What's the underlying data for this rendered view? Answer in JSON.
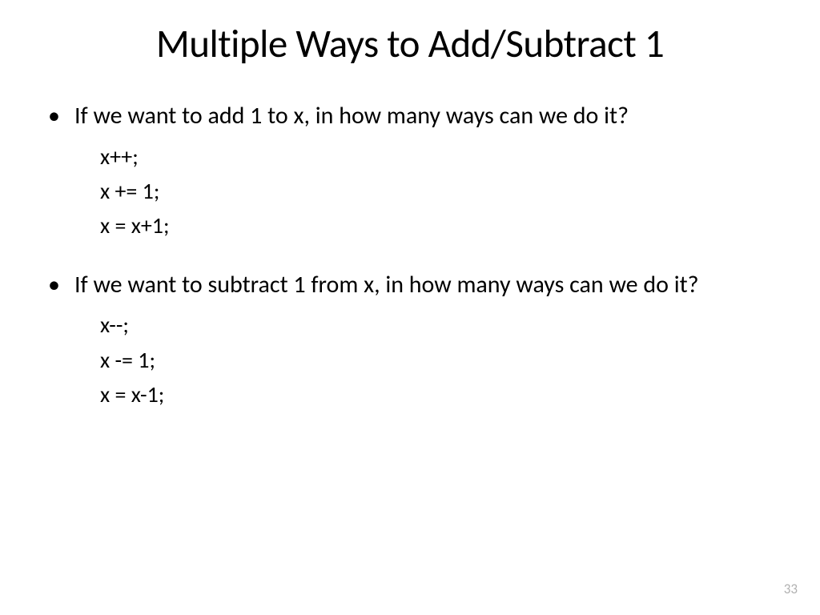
{
  "slide": {
    "title": "Multiple Ways to Add/Subtract 1",
    "sections": [
      {
        "bullet": "If we want to add 1 to x, in how many ways can we do it?",
        "code": [
          "x++;",
          "x += 1;",
          "x = x+1;"
        ]
      },
      {
        "bullet": "If we want to subtract 1 from x, in how many ways can we do it?",
        "code": [
          "x--;",
          "x -= 1;",
          "x = x-1;"
        ]
      }
    ],
    "page_number": "33"
  }
}
